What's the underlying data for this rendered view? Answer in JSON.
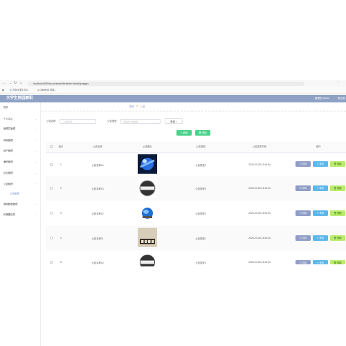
{
  "browser": {
    "address": "localhost:8080/xxxxx/admin/dist/index.html#/gonggao",
    "bookmarks": [
      "2024公告1 010...",
      "Claude AI 对话..."
    ]
  },
  "header": {
    "title": "大学生校园兼职",
    "user": "管理员 admin",
    "exit": "退出登录"
  },
  "sidebar": {
    "items": [
      {
        "label": "首页"
      },
      {
        "label": "个人中心"
      },
      {
        "label": "管理员管理"
      },
      {
        "label": "商家管理"
      },
      {
        "label": "用户管理"
      },
      {
        "label": "兼职管理"
      },
      {
        "label": "论坛管理"
      },
      {
        "label": "公告管理"
      },
      {
        "label": "公告管理"
      },
      {
        "label": "基础数据管理"
      },
      {
        "label": "轮播图信息"
      }
    ]
  },
  "breadcrumb": {
    "home": "首页",
    "current": "公告"
  },
  "filters": {
    "name_label": "公告名称",
    "name_placeholder": "公告名称",
    "type_label": "公告类型",
    "type_placeholder": "请选择公告类型",
    "search_button": "查询"
  },
  "actions": {
    "add": "新增",
    "delete": "删除"
  },
  "table": {
    "headers": [
      "索引",
      "公告名称",
      "公告图片",
      "公告类型",
      "公告发布时间",
      "操作"
    ],
    "rows": [
      {
        "index": "1",
        "name": "公告名称14",
        "type": "公告类型2",
        "time": "2023-03-25 13:44:54"
      },
      {
        "index": "2",
        "name": "公告名称13",
        "type": "公告类型3",
        "time": "2023-03-25 13:44:54"
      },
      {
        "index": "3",
        "name": "公告名称12",
        "type": "公告类型2",
        "time": "2023-03-25 13:44:54"
      },
      {
        "index": "4",
        "name": "公告名称11",
        "type": "公告类型1",
        "time": "2023-03-25 13:44:54"
      },
      {
        "index": "5",
        "name": "公告名称10",
        "type": "公告类型1",
        "time": "2023-03-25 13:44:54"
      }
    ],
    "btn_detail": "详情",
    "btn_edit": "修改",
    "btn_delete": "删除"
  },
  "colors": {
    "header": "#8ea1c5",
    "detail": "#8f9dc6",
    "edit": "#5bb7ea",
    "delete": "#b8ec6a",
    "add": "#4cd28c"
  }
}
